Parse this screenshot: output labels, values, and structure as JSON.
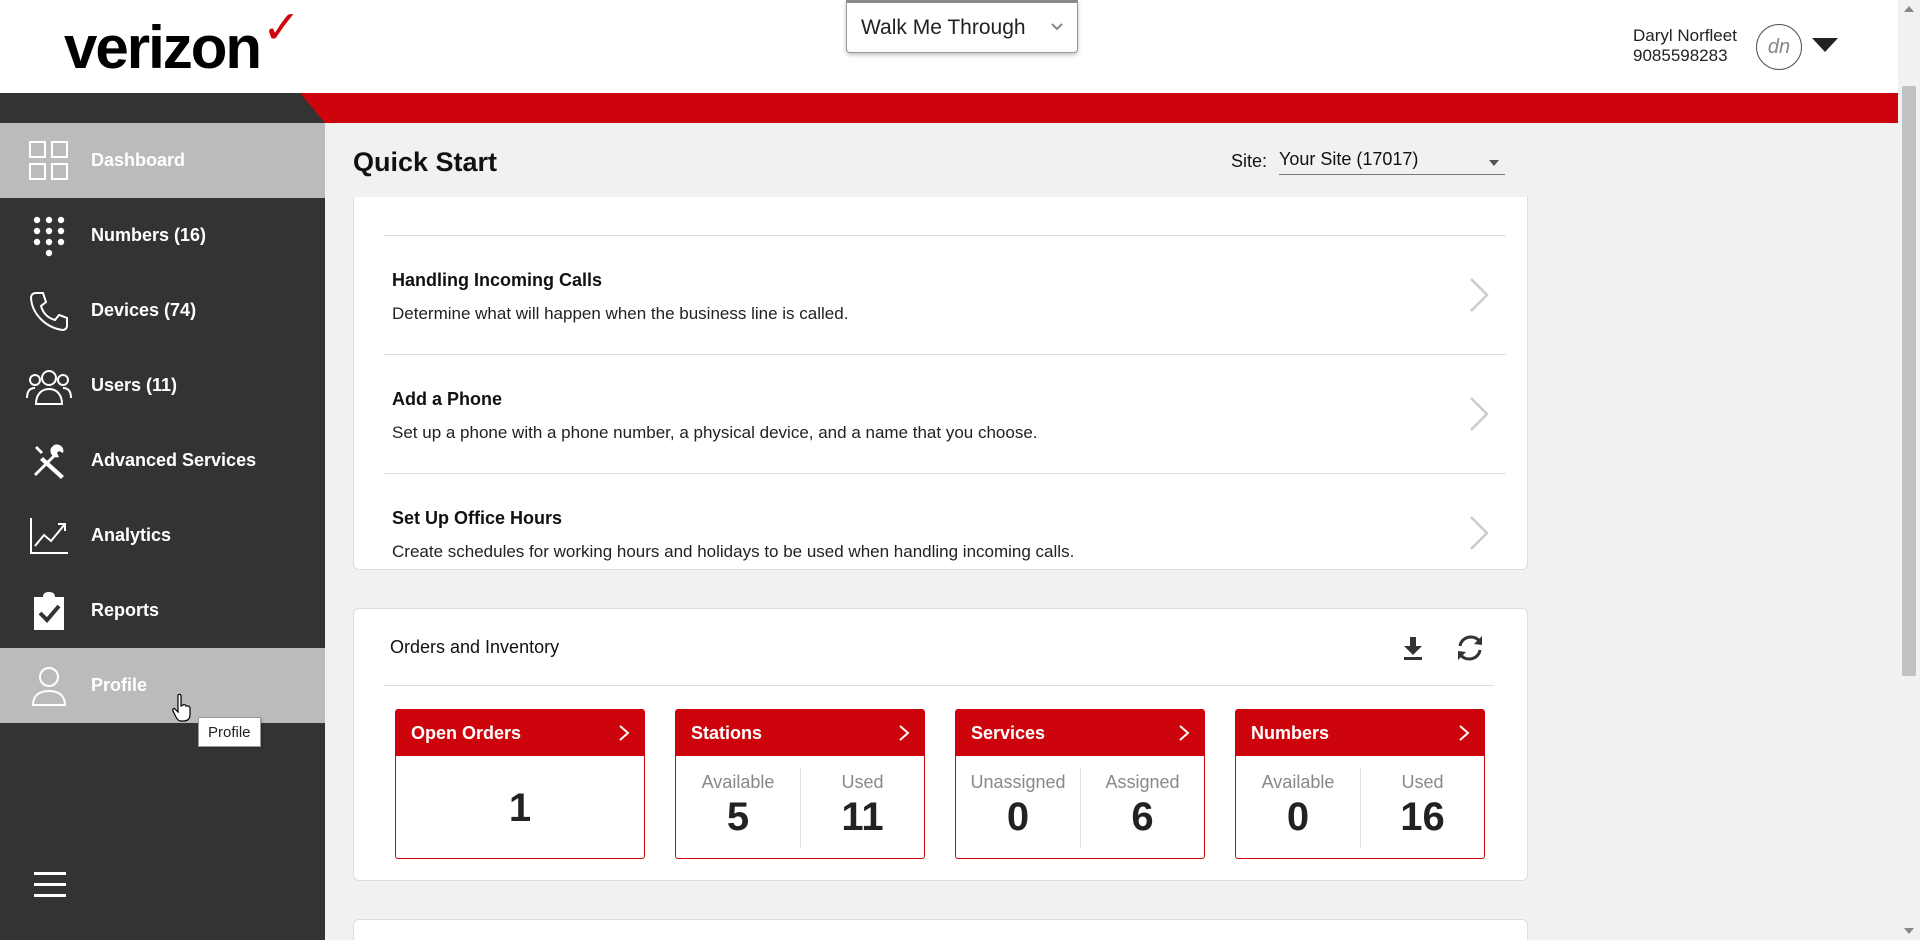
{
  "header": {
    "logo_text": "verizon",
    "logo_mark": "✓",
    "walk_me_label": "Walk Me Through",
    "user_name": "Daryl Norfleet",
    "user_phone": "9085598283",
    "avatar_initials": "dn"
  },
  "sidebar": {
    "items": [
      {
        "label": "Dashboard",
        "icon": "dashboard-grid-icon"
      },
      {
        "label": "Numbers (16)",
        "icon": "keypad-icon"
      },
      {
        "label": "Devices (74)",
        "icon": "phone-handset-icon"
      },
      {
        "label": "Users (11)",
        "icon": "users-group-icon"
      },
      {
        "label": "Advanced Services",
        "icon": "tools-icon"
      },
      {
        "label": "Analytics",
        "icon": "chart-line-icon"
      },
      {
        "label": "Reports",
        "icon": "clipboard-check-icon"
      },
      {
        "label": "Profile",
        "icon": "profile-person-icon"
      }
    ],
    "tooltip": "Profile"
  },
  "main": {
    "title": "Quick Start",
    "site_label": "Site:",
    "site_value": "Your Site (17017)",
    "quick_items": [
      {
        "title": "Handling Incoming Calls",
        "desc": "Determine what will happen when the business line is called."
      },
      {
        "title": "Add a Phone",
        "desc": "Set up a phone with a phone number, a physical device, and a name that you choose."
      },
      {
        "title": "Set Up Office Hours",
        "desc": "Create schedules for working hours and holidays to be used when handling incoming calls."
      }
    ],
    "orders": {
      "title": "Orders and Inventory",
      "tiles": [
        {
          "title": "Open Orders",
          "value": "1"
        },
        {
          "title": "Stations",
          "left_label": "Available",
          "left_value": "5",
          "right_label": "Used",
          "right_value": "11"
        },
        {
          "title": "Services",
          "left_label": "Unassigned",
          "left_value": "0",
          "right_label": "Assigned",
          "right_value": "6"
        },
        {
          "title": "Numbers",
          "left_label": "Available",
          "left_value": "0",
          "right_label": "Used",
          "right_value": "16"
        }
      ]
    }
  },
  "colors": {
    "brand_red": "#cd040b",
    "sidebar_bg": "#333333",
    "sidebar_active": "#bbbbbb",
    "main_bg": "#f0f2f2"
  }
}
